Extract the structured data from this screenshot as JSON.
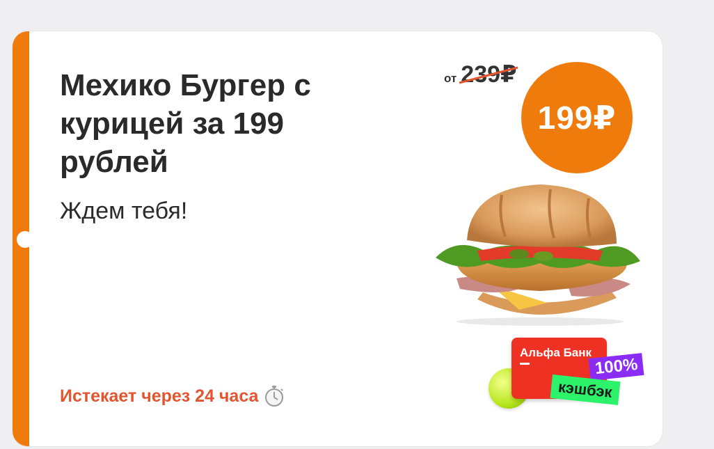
{
  "offer": {
    "title": "Мехико Бургер с курицей за 199 рублей",
    "subtitle": "Ждем тебя!",
    "expires": "Истекает через 24 часа",
    "price_prefix": "от",
    "old_price": "239₽",
    "new_price": "199₽"
  },
  "promo": {
    "bank_name": "Альфа Банк",
    "percent": "100%",
    "cashback": "кэшбэк"
  },
  "colors": {
    "accent": "#ef7b0c",
    "expire_text": "#e2552e",
    "bank_red": "#ef3124",
    "percent_purple": "#8b2cf5",
    "cashback_green": "#2cf36a"
  },
  "icons": {
    "timer": "stopwatch-icon"
  }
}
